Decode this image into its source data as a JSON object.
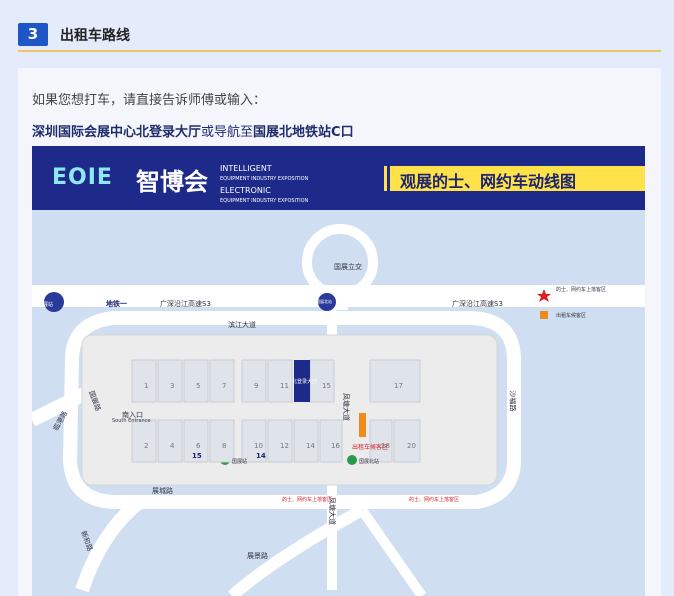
{
  "section": {
    "number": "3",
    "title": "出租车路线"
  },
  "intro": "如果您想打车，请直接告诉师傅或输入：",
  "destination": {
    "part1": "深圳国际会展中心北登录大厅",
    "connector": "或导航至",
    "part2": "国展北地铁站C口"
  },
  "map": {
    "logo_text": "EOIE",
    "logo_cn": "智博会",
    "logo_en": [
      "INTELLIGENT",
      "EQUIPMENT INDUSTRY EXPOSITION",
      "ELECTRONIC",
      "EQUIPMENT INDUSTRY EXPOSITION"
    ],
    "banner": "观展的士、网约车动线图",
    "labels": {
      "interchange": "国展立交",
      "metro_line": "地铁一",
      "highway_left": "广深沿江高速S3",
      "highway_right": "广深沿江高速S3",
      "road_binjiang": "滨江大道",
      "road_zhancheng": "展城路",
      "road_lingangnan": "临港路",
      "road_haixiu": "沙福路",
      "road_zhanjing": "展景路",
      "road_fenghuang": "凤塘大道",
      "road_fenghuang2": "凤塘大道",
      "road_guozhan": "国展路",
      "road_xinzhi": "新和路",
      "south_entrance": "南入口",
      "south_entrance_en": "South Entrance",
      "taxi_area": "出租车候客区",
      "pickup_label": "的士、网约车上落客区",
      "pickup_label2": "的士、网约车上落客区",
      "station_left": "国展站",
      "station_right": "国展北站",
      "gate_15": "15",
      "gate_14": "14",
      "hall_label": "北登录大厅",
      "legend_pickup": "的士、网约车上落客区",
      "legend_taxi": "出租车候客区",
      "left_circle": "国展站",
      "right_circle": "国展北站"
    },
    "halls_top": [
      "1",
      "3",
      "5",
      "7",
      "9",
      "11",
      "15",
      "17"
    ],
    "halls_bottom": [
      "2",
      "4",
      "6",
      "8",
      "10",
      "12",
      "14",
      "16",
      "18",
      "20"
    ]
  }
}
